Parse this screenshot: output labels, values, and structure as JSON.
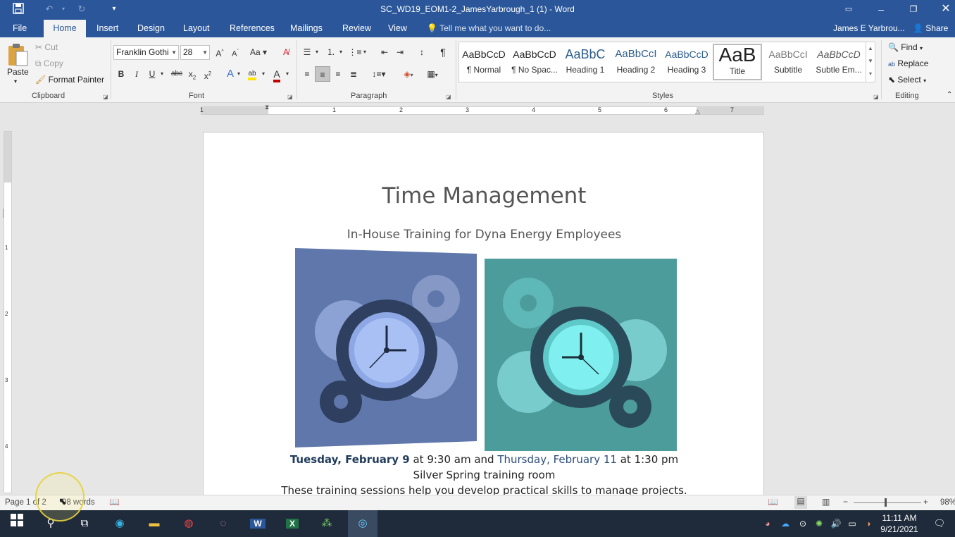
{
  "window": {
    "title": "SC_WD19_EOM1-2_JamesYarbrough_1 (1) - Word"
  },
  "tabs": [
    "File",
    "Home",
    "Insert",
    "Design",
    "Layout",
    "References",
    "Mailings",
    "Review",
    "View"
  ],
  "tell_me": "Tell me what you want to do...",
  "user": "James E Yarbrou...",
  "share": "Share",
  "clipboard": {
    "paste": "Paste",
    "cut": "Cut",
    "copy": "Copy",
    "format_painter": "Format Painter",
    "label": "Clipboard"
  },
  "font": {
    "name": "Franklin Gothi",
    "size": "28",
    "label": "Font"
  },
  "paragraph": {
    "label": "Paragraph"
  },
  "styles": {
    "label": "Styles",
    "items": [
      {
        "preview": "AaBbCcD",
        "name": "¶ Normal"
      },
      {
        "preview": "AaBbCcD",
        "name": "¶ No Spac..."
      },
      {
        "preview": "AaBbC",
        "name": "Heading 1"
      },
      {
        "preview": "AaBbCcI",
        "name": "Heading 2"
      },
      {
        "preview": "AaBbCcD",
        "name": "Heading 3"
      },
      {
        "preview": "AaB",
        "name": "Title"
      },
      {
        "preview": "AaBbCcI",
        "name": "Subtitle"
      },
      {
        "preview": "AaBbCcD",
        "name": "Subtle Em..."
      }
    ]
  },
  "editing": {
    "find": "Find",
    "replace": "Replace",
    "select": "Select",
    "label": "Editing"
  },
  "ruler": {
    "h": [
      "1",
      "1",
      "2",
      "3",
      "4",
      "5",
      "6",
      "7"
    ],
    "v": [
      "1",
      "2",
      "3",
      "4"
    ]
  },
  "document": {
    "title": "Time Management",
    "subtitle": "In-House Training for Dyna Energy Employees",
    "line1": {
      "d1": "Tuesday, February 9",
      "t1": " at 9:30 am and ",
      "d2": "Thursday, February 11",
      "t2": " at 1:30 pm"
    },
    "line2": "Silver Spring training room",
    "line3": "These training sessions help you develop practical skills to manage projects."
  },
  "status": {
    "page": "Page 1 of 2",
    "words": "98 words",
    "zoom": "98%"
  },
  "taskbar": {
    "time": "11:11 AM",
    "date": "9/21/2021"
  },
  "colors": {
    "word_blue": "#2b579a",
    "img1_bg": "#5f77ab",
    "img2_bg": "#4d9c9c"
  }
}
